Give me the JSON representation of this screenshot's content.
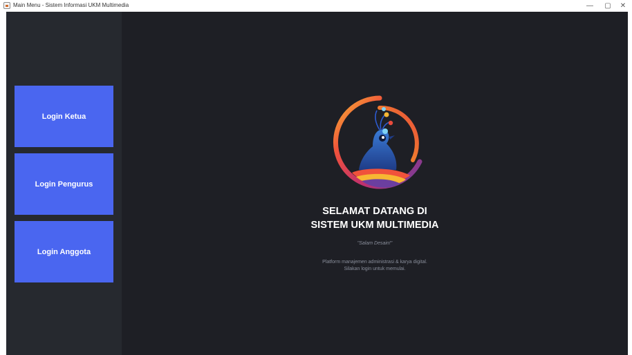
{
  "window": {
    "title": "Main Menu - Sistem Informasi UKM Multimedia",
    "controls": {
      "minimize": "—",
      "restore": "▢",
      "close": "✕"
    }
  },
  "sidebar": {
    "buttons": [
      {
        "label": "Login Ketua"
      },
      {
        "label": "Login Pengurus"
      },
      {
        "label": "Login Anggota"
      }
    ]
  },
  "main": {
    "logo_icon": "peacock-logo-icon",
    "heading_line1": "SELAMAT DATANG DI",
    "heading_line2": "SISTEM UKM MULTIMEDIA",
    "tagline": "\"Salam Desain!\"",
    "description_line1": "Platform manajemen administrasi & karya digital.",
    "description_line2": "Silakan login untuk memulai."
  },
  "colors": {
    "sidebar_bg": "#26292f",
    "main_bg": "#1e1f25",
    "button_bg": "#4a66f0",
    "button_text": "#ffffff",
    "heading_text": "#ffffff",
    "muted_text": "#8a8f9c"
  }
}
